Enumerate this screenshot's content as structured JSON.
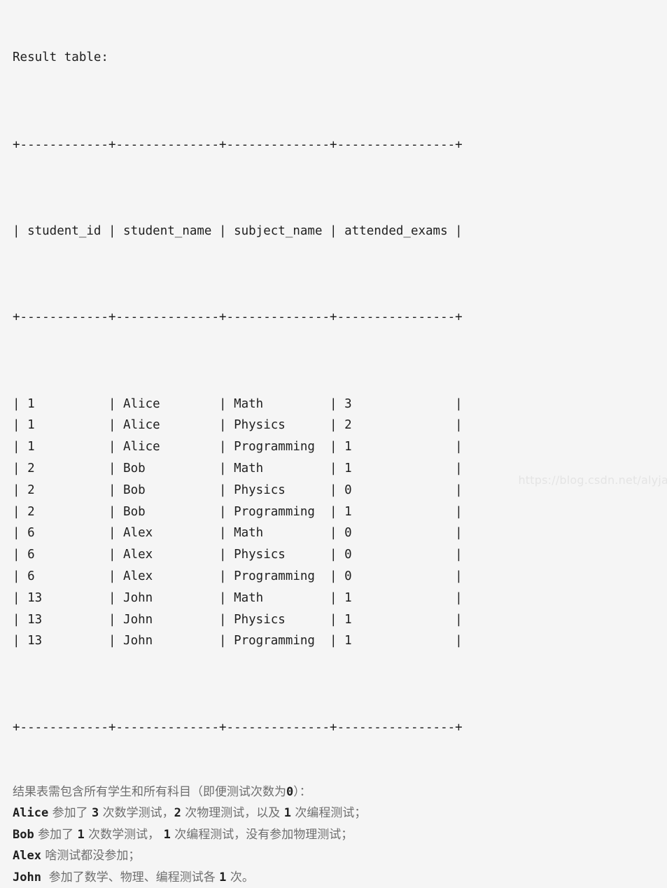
{
  "page": {
    "background_color": "#f5f5f5",
    "text_color": "#1f1f1f",
    "note_color": "#6e6e6e",
    "watermark_color": "#e4e4e4"
  },
  "title": "Result table:",
  "table": {
    "columns": [
      {
        "key": "student_id",
        "header": "student_id",
        "inner_width": 12
      },
      {
        "key": "student_name",
        "header": "student_name",
        "inner_width": 14
      },
      {
        "key": "subject_name",
        "header": "subject_name",
        "inner_width": 14
      },
      {
        "key": "attended_exams",
        "header": "attended_exams",
        "inner_width": 16
      }
    ],
    "separator": "+------------+--------------+--------------+----------------+",
    "header_row": "| student_id | student_name | subject_name | attended_exams |",
    "rows": [
      {
        "student_id": "1",
        "student_name": "Alice",
        "subject_name": "Math",
        "attended_exams": "3"
      },
      {
        "student_id": "1",
        "student_name": "Alice",
        "subject_name": "Physics",
        "attended_exams": "2"
      },
      {
        "student_id": "1",
        "student_name": "Alice",
        "subject_name": "Programming",
        "attended_exams": "1"
      },
      {
        "student_id": "2",
        "student_name": "Bob",
        "subject_name": "Math",
        "attended_exams": "1"
      },
      {
        "student_id": "2",
        "student_name": "Bob",
        "subject_name": "Physics",
        "attended_exams": "0"
      },
      {
        "student_id": "2",
        "student_name": "Bob",
        "subject_name": "Programming",
        "attended_exams": "1"
      },
      {
        "student_id": "6",
        "student_name": "Alex",
        "subject_name": "Math",
        "attended_exams": "0"
      },
      {
        "student_id": "6",
        "student_name": "Alex",
        "subject_name": "Physics",
        "attended_exams": "0"
      },
      {
        "student_id": "6",
        "student_name": "Alex",
        "subject_name": "Programming",
        "attended_exams": "0"
      },
      {
        "student_id": "13",
        "student_name": "John",
        "subject_name": "Math",
        "attended_exams": "1"
      },
      {
        "student_id": "13",
        "student_name": "John",
        "subject_name": "Physics",
        "attended_exams": "1"
      },
      {
        "student_id": "13",
        "student_name": "John",
        "subject_name": "Programming",
        "attended_exams": "1"
      }
    ]
  },
  "notes": [
    {
      "id": "note-requirement",
      "segments": [
        {
          "type": "cn",
          "text": "结果表需包含所有学生和所有科目（即便测试次数为"
        },
        {
          "type": "mono",
          "text": "0"
        },
        {
          "type": "cn",
          "text": "）："
        }
      ]
    },
    {
      "id": "note-alice",
      "segments": [
        {
          "type": "mono",
          "text": "Alice"
        },
        {
          "type": "cn",
          "text": " 参加了 "
        },
        {
          "type": "mono",
          "text": "3"
        },
        {
          "type": "cn",
          "text": " 次数学测试，"
        },
        {
          "type": "mono",
          "text": "2"
        },
        {
          "type": "cn",
          "text": " 次物理测试，以及 "
        },
        {
          "type": "mono",
          "text": "1"
        },
        {
          "type": "cn",
          "text": " 次编程测试；"
        }
      ]
    },
    {
      "id": "note-bob",
      "segments": [
        {
          "type": "mono",
          "text": "Bob"
        },
        {
          "type": "cn",
          "text": " 参加了 "
        },
        {
          "type": "mono",
          "text": "1"
        },
        {
          "type": "cn",
          "text": " 次数学测试， "
        },
        {
          "type": "mono",
          "text": "1"
        },
        {
          "type": "cn",
          "text": " 次编程测试，没有参加物理测试；"
        }
      ]
    },
    {
      "id": "note-alex",
      "segments": [
        {
          "type": "mono",
          "text": "Alex"
        },
        {
          "type": "cn",
          "text": " 啥测试都没参加；"
        }
      ]
    },
    {
      "id": "note-john",
      "segments": [
        {
          "type": "mono",
          "text": "John"
        },
        {
          "type": "cn",
          "text": "  参加了数学、物理、编程测试各 "
        },
        {
          "type": "mono",
          "text": "1"
        },
        {
          "type": "cn",
          "text": " 次。"
        }
      ]
    }
  ],
  "watermark": "https://blog.csdn.net/alyja"
}
